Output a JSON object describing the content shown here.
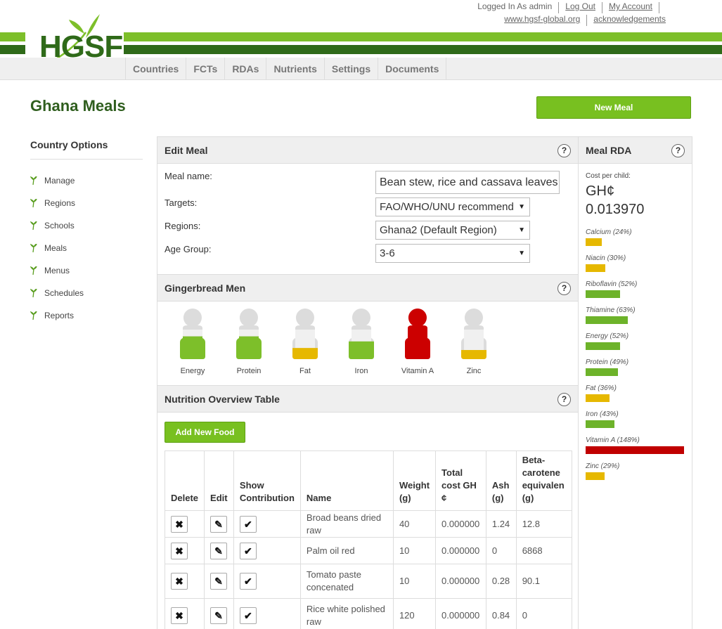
{
  "header": {
    "logged_in": "Logged In As admin",
    "logout": "Log Out",
    "my_account": "My Account",
    "website": "www.hgsf-global.org",
    "acknowledgements": "acknowledgements",
    "logo_text": "HGSF"
  },
  "nav": {
    "tabs": [
      "Countries",
      "FCTs",
      "RDAs",
      "Nutrients",
      "Settings",
      "Documents"
    ]
  },
  "page": {
    "title": "Ghana Meals",
    "new_meal": "New Meal"
  },
  "sidebar": {
    "title": "Country Options",
    "items": [
      "Manage",
      "Regions",
      "Schools",
      "Meals",
      "Menus",
      "Schedules",
      "Reports"
    ]
  },
  "edit_meal": {
    "title": "Edit Meal",
    "help": "?",
    "meal_name_label": "Meal name:",
    "meal_name_value": "Bean stew, rice and cassava leaves",
    "targets_label": "Targets:",
    "targets_value": "FAO/WHO/UNU recommend",
    "regions_label": "Regions:",
    "regions_value": "Ghana2 (Default Region)",
    "age_label": "Age Group:",
    "age_value": "3-6"
  },
  "gingerbread": {
    "title": "Gingerbread Men",
    "help": "?",
    "men": [
      {
        "label": "Energy",
        "fill": 0.45,
        "color": "#7dbf2a"
      },
      {
        "label": "Protein",
        "fill": 0.45,
        "color": "#7dbf2a"
      },
      {
        "label": "Fat",
        "fill": 0.22,
        "color": "#e6b800"
      },
      {
        "label": "Iron",
        "fill": 0.35,
        "color": "#7dbf2a"
      },
      {
        "label": "Vitamin A",
        "fill": 1.0,
        "color": "#cc0000"
      },
      {
        "label": "Zinc",
        "fill": 0.18,
        "color": "#e6b800"
      }
    ]
  },
  "nutrition": {
    "title": "Nutrition Overview Table",
    "help": "?",
    "add_food": "Add New Food",
    "headers": {
      "delete": "Delete",
      "edit": "Edit",
      "show1": "Show",
      "show2": "Contribution",
      "name": "Name",
      "weight1": "Weight",
      "weight2": "(g)",
      "cost1": "Total",
      "cost2": "cost GH",
      "cost3": "¢",
      "ash1": "Ash",
      "ash2": "(g)",
      "beta1": "Beta-",
      "beta2": "carotene",
      "beta3": "equivalen",
      "beta4": "(g)"
    },
    "rows": [
      {
        "name1": "Broad beans dried raw",
        "name2": "",
        "weight": "40",
        "cost": "0.000000",
        "ash": "1.24",
        "beta": "12.8"
      },
      {
        "name1": "Palm oil red",
        "name2": "",
        "weight": "10",
        "cost": "0.000000",
        "ash": "0",
        "beta": "6868"
      },
      {
        "name1": "Tomato paste",
        "name2": "concenated",
        "weight": "10",
        "cost": "0.000000",
        "ash": "0.28",
        "beta": "90.1"
      },
      {
        "name1": "Rice white polished",
        "name2": "raw",
        "weight": "120",
        "cost": "0.000000",
        "ash": "0.84",
        "beta": "0"
      }
    ]
  },
  "rda": {
    "title": "Meal RDA",
    "help": "?",
    "cost_label": "Cost per child:",
    "cost_currency": "GH¢",
    "cost_value": "0.013970",
    "items": [
      {
        "label": "Calcium (24%)",
        "percent": 24,
        "color": "#e6b800"
      },
      {
        "label": "Niacin (30%)",
        "percent": 30,
        "color": "#e6b800"
      },
      {
        "label": "Riboflavin (52%)",
        "percent": 52,
        "color": "#6db32a"
      },
      {
        "label": "Thiamine (63%)",
        "percent": 63,
        "color": "#6db32a"
      },
      {
        "label": "Energy (52%)",
        "percent": 52,
        "color": "#6db32a"
      },
      {
        "label": "Protein (49%)",
        "percent": 49,
        "color": "#6db32a"
      },
      {
        "label": "Fat (36%)",
        "percent": 36,
        "color": "#e6b800"
      },
      {
        "label": "Iron (43%)",
        "percent": 43,
        "color": "#6db32a"
      },
      {
        "label": "Vitamin A (148%)",
        "percent": 148,
        "color": "#c00000"
      },
      {
        "label": "Zinc (29%)",
        "percent": 29,
        "color": "#e6b800"
      }
    ]
  }
}
